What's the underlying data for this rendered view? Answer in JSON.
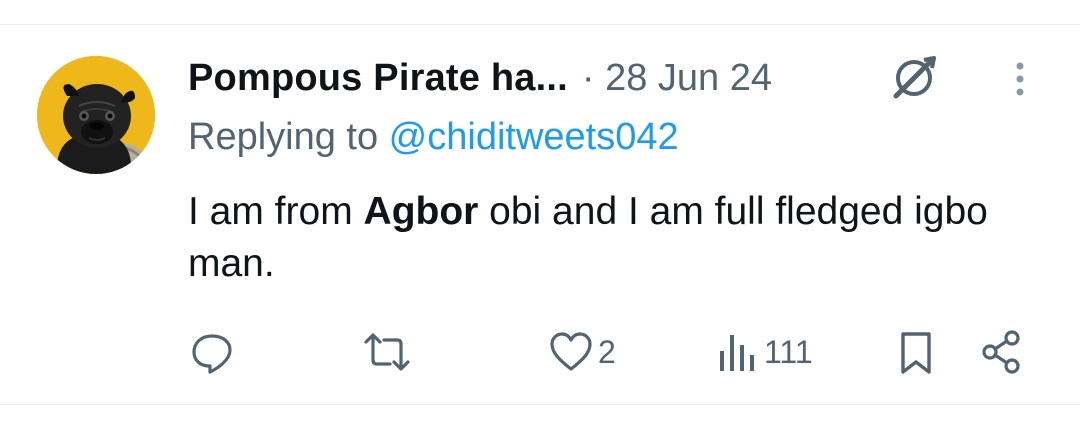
{
  "tweet": {
    "display_name": "Pompous Pirate ha...",
    "meta": "· 28 Jun 24",
    "replying_prefix": "Replying to ",
    "replying_handle": "@chiditweets042",
    "text_before": "I am from ",
    "text_bold": "Agbor",
    "text_after": " obi and I am full fledged igbo man.",
    "avatar": "pug-avatar",
    "verified_icon": "grok-slash-icon"
  },
  "actions": {
    "reply": {
      "icon": "reply-icon",
      "count": ""
    },
    "retweet": {
      "icon": "retweet-icon",
      "count": ""
    },
    "like": {
      "icon": "heart-icon",
      "count": "2"
    },
    "views": {
      "icon": "views-icon",
      "count": "111"
    },
    "bookmark": {
      "icon": "bookmark-icon"
    },
    "share": {
      "icon": "share-icon"
    }
  },
  "colors": {
    "link": "#1d9bf0",
    "muted": "#536471",
    "text": "#0f1419",
    "avatar_bg": "#efb81a"
  }
}
